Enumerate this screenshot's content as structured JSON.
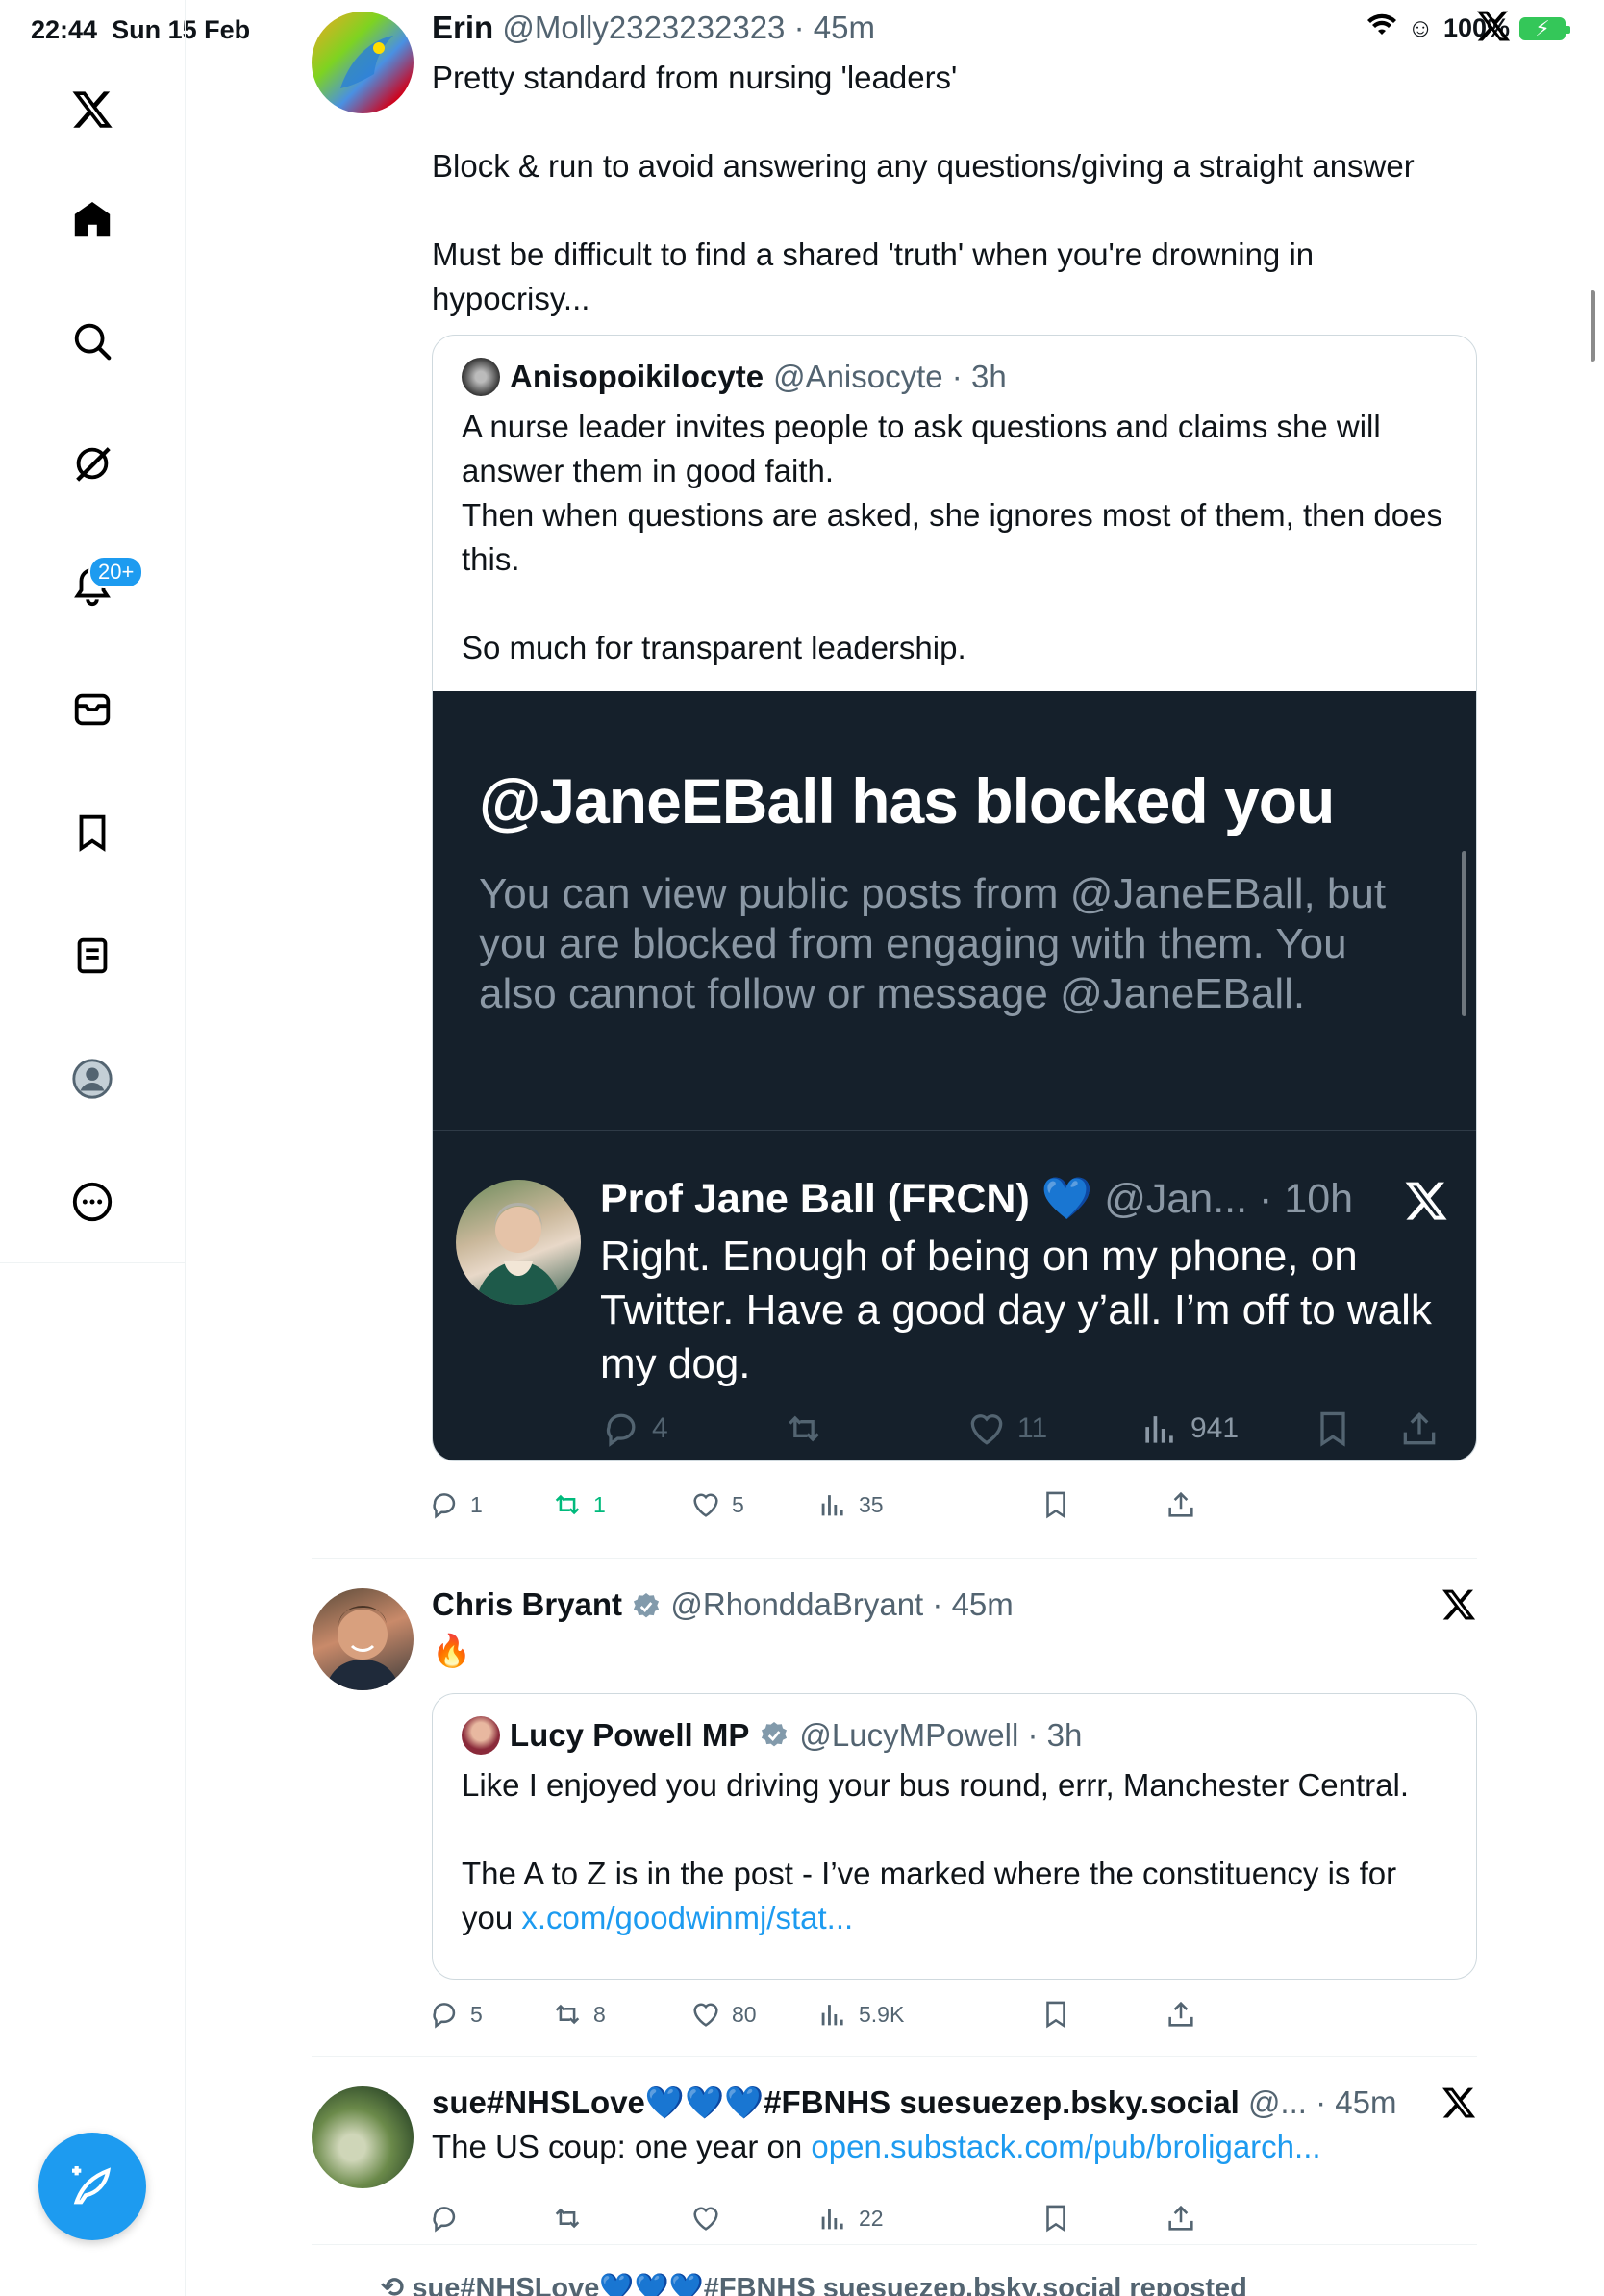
{
  "status_bar": {
    "time": "22:44",
    "date": "Sun 15 Feb",
    "battery": "100%"
  },
  "sidebar": {
    "notifications_badge": "20+"
  },
  "tweets": [
    {
      "name": "Erin",
      "handle": "@Molly2323232323",
      "time": "45m",
      "text": "Pretty standard from nursing 'leaders'\n\nBlock & run to avoid answering any questions/giving a straight answer\n\nMust be difficult to find a shared 'truth' when you're drowning in hypocrisy...",
      "quote": {
        "name": "Anisopoikilocyte",
        "handle": "@Anisocyte",
        "time": "3h",
        "text": "A nurse leader invites people to ask questions and claims she will answer them in good faith.\nThen when questions are asked, she ignores most of them, then does this.\n\nSo much for transparent leadership.",
        "media": {
          "title": "@JaneEBall has blocked you",
          "subtitle": "You can view public posts from @JaneEBall, but you are blocked from engaging with them. You also cannot follow or message @JaneEBall.",
          "embedded": {
            "name": "Prof Jane Ball (FRCN)",
            "handle": "@Jan...",
            "time": "10h",
            "text": "Right. Enough of being on my phone, on Twitter. Have a good day y’all. I’m off to walk my dog.",
            "replies": "4",
            "likes": "11",
            "views": "941"
          }
        }
      },
      "stats": {
        "replies": "1",
        "reposts": "1",
        "likes": "5",
        "views": "35"
      }
    },
    {
      "name": "Chris Bryant",
      "handle": "@RhonddaBryant",
      "time": "45m",
      "text": "🔥",
      "quote": {
        "name": "Lucy Powell MP",
        "handle": "@LucyMPowell",
        "time": "3h",
        "text": "Like I enjoyed you driving your bus round, errr, Manchester Central.\n\nThe A to Z is in the post - I’ve marked where the constituency is for you ",
        "link": "x.com/goodwinmj/stat..."
      },
      "stats": {
        "replies": "5",
        "reposts": "8",
        "likes": "80",
        "views": "5.9K"
      }
    },
    {
      "name": "sue#NHSLove💙💙💙#FBNHS suesuezep.bsky.social",
      "handle": "@...",
      "time": "45m",
      "text": "The US coup: one year on ",
      "link": "open.substack.com/pub/broligarch...",
      "stats": {
        "replies": "",
        "reposts": "",
        "likes": "",
        "views": "22"
      }
    }
  ],
  "bottom_repost": "sue#NHSLove💙💙💙#FBNHS suesuezep.bsky.social reposted",
  "colors": {
    "accent": "#1d9bf0",
    "repost_green": "#00ba7c",
    "dark_card": "#15202b"
  }
}
